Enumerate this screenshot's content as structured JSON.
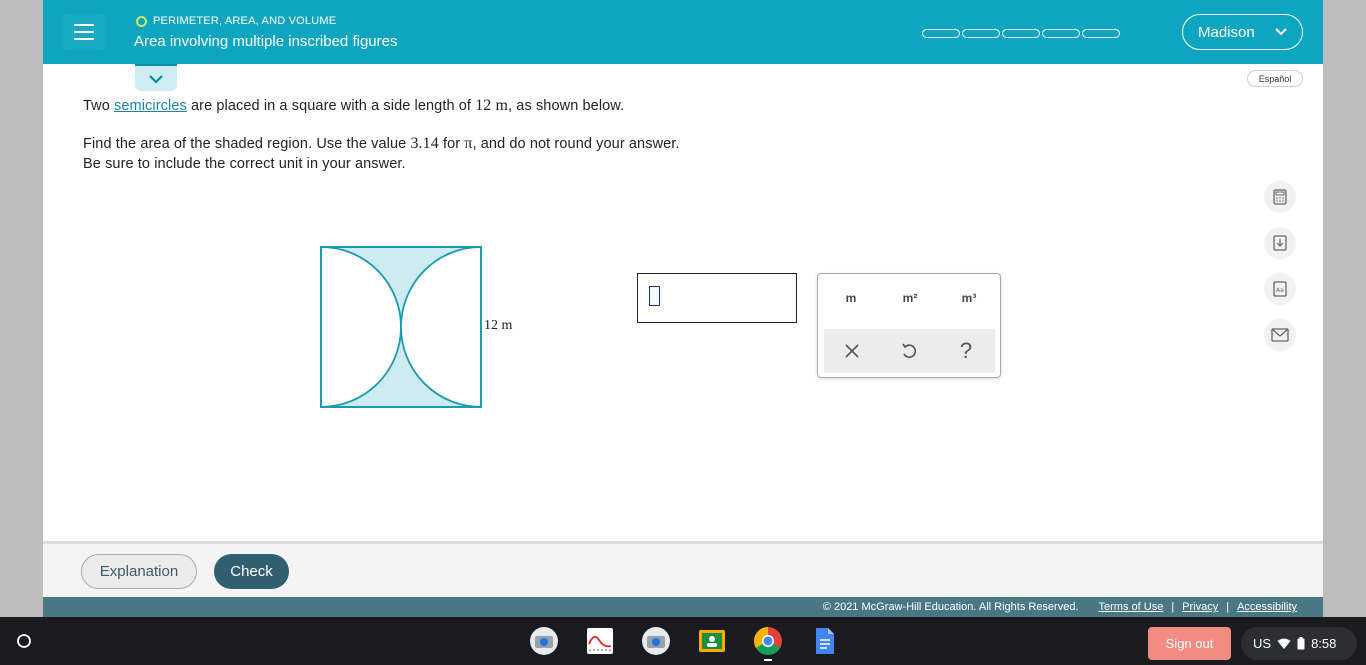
{
  "header": {
    "topic": "PERIMETER, AREA, AND VOLUME",
    "title": "Area involving multiple inscribed figures",
    "user_name": "Madison"
  },
  "language_button": "Español",
  "problem": {
    "line1_pre": "Two ",
    "line1_link": "semicircles",
    "line1_mid": " are placed in a square with a side length of ",
    "line1_value": "12 m",
    "line1_post": ", as shown below.",
    "line2_pre": "Find the area of the shaded region. Use the value ",
    "line2_pi_value": "3.14",
    "line2_mid": " for ",
    "line2_pi": "π",
    "line2_post": ", and do not round your answer.",
    "line3": "Be sure to include the correct unit in your answer."
  },
  "figure": {
    "side_label": "12  m",
    "colors": {
      "stroke": "#1a9bb3",
      "shade": "#cdebf1"
    }
  },
  "unit_panel": {
    "units": [
      "m",
      "m²",
      "m³"
    ],
    "help_label": "?"
  },
  "footer": {
    "explanation_label": "Explanation",
    "check_label": "Check",
    "copyright": "© 2021 McGraw-Hill Education. All Rights Reserved.",
    "links": [
      "Terms of Use",
      "Privacy",
      "Accessibility"
    ],
    "separator": "|"
  },
  "taskbar": {
    "signout_label": "Sign out",
    "locale": "US",
    "time": "8:58",
    "apps": [
      "camera-icon",
      "wave-app-icon",
      "camera-icon",
      "classroom-icon",
      "chrome-icon",
      "docs-icon"
    ]
  },
  "colors": {
    "header": "#0ea5c0",
    "check_button": "#2f5f70",
    "signout": "#f28b82"
  }
}
